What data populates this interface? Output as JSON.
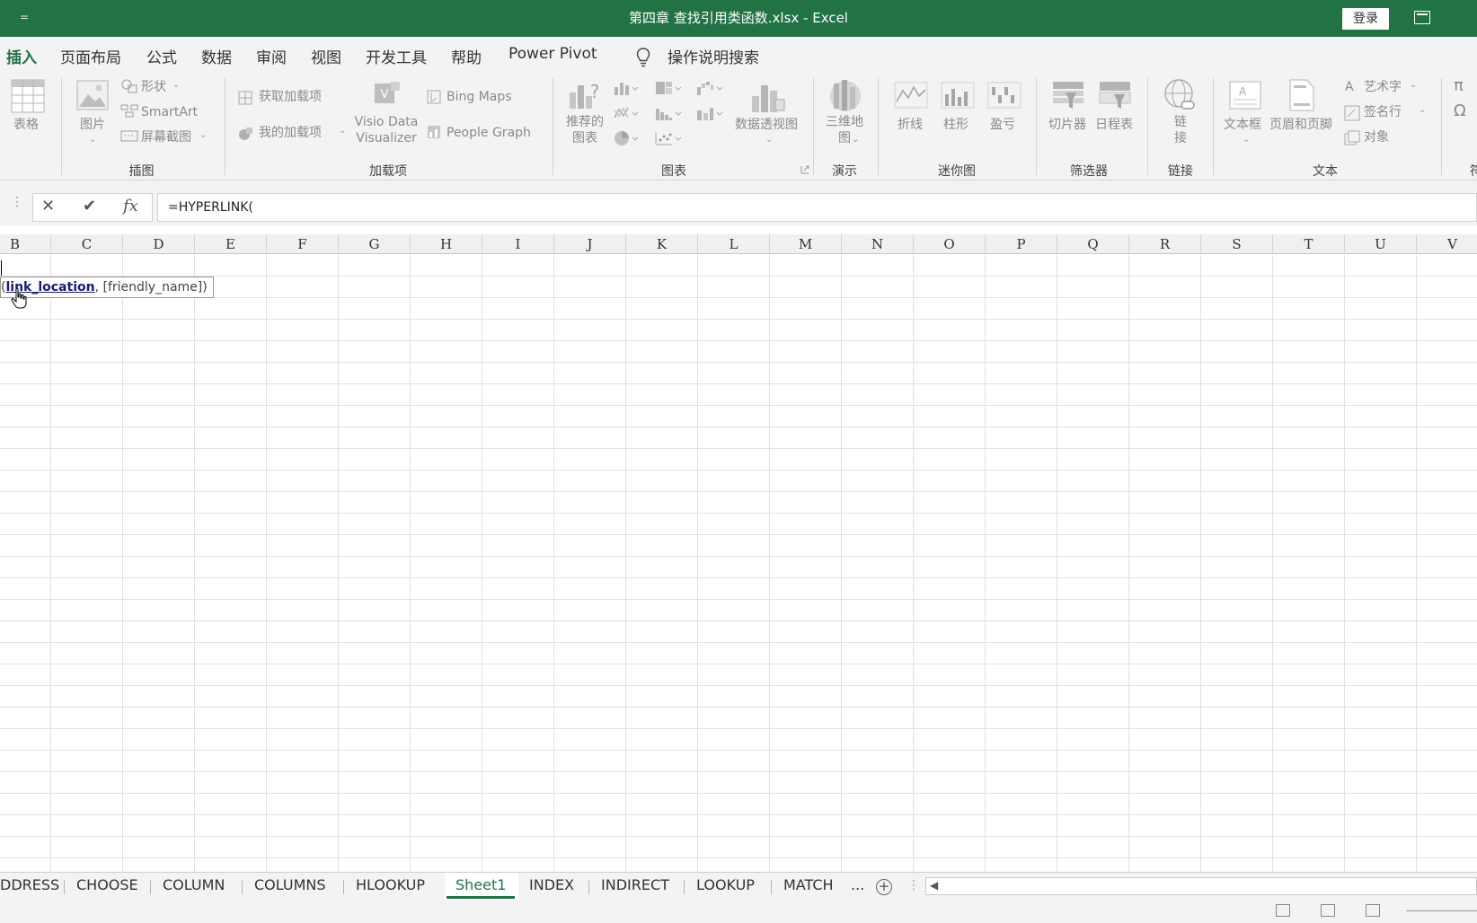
{
  "titlebar": {
    "qat_label": "=",
    "title": "第四章 查找引用类函数.xlsx  -  Excel",
    "login_label": "登录"
  },
  "menu": {
    "tabs": [
      {
        "label": "插入",
        "active": true
      },
      {
        "label": "页面布局"
      },
      {
        "label": "公式"
      },
      {
        "label": "数据"
      },
      {
        "label": "审阅"
      },
      {
        "label": "视图"
      },
      {
        "label": "开发工具"
      },
      {
        "label": "帮助"
      },
      {
        "label": "Power Pivot"
      }
    ],
    "search_label": "操作说明搜索"
  },
  "ribbon": {
    "table_label": "表格",
    "picture_label": "图片",
    "shapes_label": "形状",
    "smartart_label": "SmartArt",
    "screenshot_label": "屏幕截图",
    "group_illustrations": "插图",
    "get_addins_label": "获取加载项",
    "my_addins_label": "我的加载项",
    "visio_label_1": "Visio Data",
    "visio_label_2": "Visualizer",
    "bing_maps_label": "Bing Maps",
    "people_graph_label": "People Graph",
    "group_addins": "加载项",
    "recommended_charts_1": "推荐的",
    "recommended_charts_2": "图表",
    "pivot_chart_label": "数据透视图",
    "group_charts": "图表",
    "map3d_label_1": "三维地",
    "map3d_label_2": "图",
    "group_tours": "演示",
    "line_label": "折线",
    "column_label": "柱形",
    "winloss_label": "盈亏",
    "group_sparklines": "迷你图",
    "slicer_label": "切片器",
    "timeline_label": "日程表",
    "group_filters": "筛选器",
    "link_label_1": "链",
    "link_label_2": "接",
    "group_links": "链接",
    "textbox_label": "文本框",
    "header_footer_label": "页眉和页脚",
    "wordart_label": "艺术字",
    "signature_label": "签名行",
    "object_label": "对象",
    "group_text": "文本",
    "pi_label": "π",
    "omega_label": "Ω",
    "symbols_group_partial": "符"
  },
  "formula_bar": {
    "cancel_label": "✕",
    "enter_label": "✔",
    "fx_label": "fx",
    "formula": "=HYPERLINK("
  },
  "grid": {
    "columns": [
      "B",
      "C",
      "D",
      "E",
      "F",
      "G",
      "H",
      "I",
      "J",
      "K",
      "L",
      "M",
      "N",
      "O",
      "P",
      "Q",
      "R",
      "S",
      "T",
      "U",
      "V"
    ],
    "tooltip_open": "(",
    "tooltip_arg1": "link_location",
    "tooltip_rest": ", [friendly_name])"
  },
  "sheets": {
    "tabs": [
      {
        "label": "DDRESS"
      },
      {
        "label": "CHOOSE"
      },
      {
        "label": "COLUMN"
      },
      {
        "label": "COLUMNS"
      },
      {
        "label": "HLOOKUP"
      },
      {
        "label": "Sheet1",
        "active": true
      },
      {
        "label": "INDEX"
      },
      {
        "label": "INDIRECT"
      },
      {
        "label": "LOOKUP"
      },
      {
        "label": "MATCH"
      }
    ],
    "more_label": "...",
    "add_label": "+"
  },
  "colors": {
    "accent": "#217346"
  }
}
